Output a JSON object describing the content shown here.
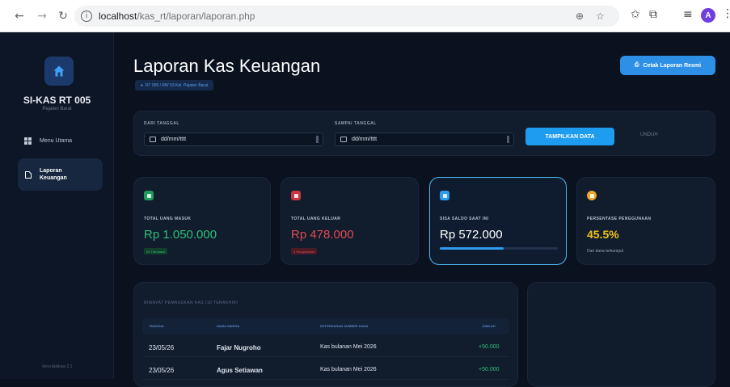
{
  "browser": {
    "url_host": "localhost",
    "url_path": "/kas_rt/laporan/laporan.php",
    "profile_initial": "A"
  },
  "sidebar": {
    "app_name": "SI-KAS RT 005",
    "app_sub": "Pejaten Barat",
    "items": [
      {
        "label": "Menu Utama",
        "icon": "grid-icon"
      },
      {
        "label_line1": "Laporan",
        "label_line2": "Keuangan",
        "icon": "document-icon",
        "active": true
      }
    ],
    "version": "Versi Aplikasi 2.1"
  },
  "header": {
    "title": "Laporan Kas Keuangan",
    "location": "RT 005 / RW 03 Kel. Pejaten Barat",
    "print_button": "Cetak Laporan Resmi"
  },
  "filter": {
    "from_label": "DARI TANGGAL",
    "from_value": "dd/mm/tttt",
    "to_label": "SAMPAI TANGGAL",
    "to_value": "dd/mm/tttt",
    "show_button": "TAMPILKAN DATA",
    "download_button": "UNDUH"
  },
  "stats": [
    {
      "label": "TOTAL UANG MASUK",
      "value": "Rp 1.050.000",
      "sub": "21 Transaksi",
      "color": "#2cc07a",
      "icon_color": "#1f9b5c"
    },
    {
      "label": "TOTAL UANG KELUAR",
      "value": "Rp 478.000",
      "sub": "3 Pengeluaran",
      "color": "#e24a55",
      "icon_color": "#c73742"
    },
    {
      "label": "SISA SALDO SAAT INI",
      "value": "Rp 572.000",
      "progress": 0.54,
      "color": "#ffffff",
      "icon_color": "#2d9cf0"
    },
    {
      "label": "PERSENTASE PENGGUNAAN",
      "value": "45.5%",
      "sub": "Dari dana terkumpul",
      "color": "#f0c419",
      "icon_color": "#e9a92c"
    }
  ],
  "table": {
    "title": "RIWAYAT PEMASUKAN KAS (10 TERAKHIR)",
    "columns": [
      "TANGGAL",
      "NAMA WARGA",
      "KETERANGAN SUMBER DANA",
      "JUMLAH"
    ],
    "rows": [
      {
        "date": "23/05/26",
        "name": "Fajar Nugroho",
        "desc": "Kas bulanan Mei 2026",
        "amount": "+50.000"
      },
      {
        "date": "23/05/26",
        "name": "Agus Setiawan",
        "desc": "Kas bulanan Mei 2026",
        "amount": "+50.000"
      }
    ]
  }
}
